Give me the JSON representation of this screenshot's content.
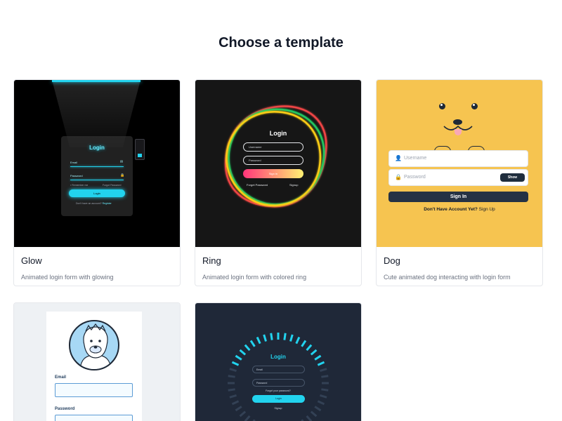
{
  "page": {
    "title": "Choose a template"
  },
  "templates": [
    {
      "name": "Glow",
      "description": "Animated login form with glowing",
      "preview": {
        "title": "Login",
        "email_label": "Email",
        "password_label": "Password",
        "remember_label": "Remember me",
        "forgot_label": "Forgot Password",
        "button_label": "Login",
        "signup_text": "Don't have an account?",
        "signup_link": "Register",
        "accent_color": "#22d3ee"
      }
    },
    {
      "name": "Ring",
      "description": "Animated login form with colored ring",
      "preview": {
        "title": "Login",
        "username_placeholder": "Username",
        "password_placeholder": "Password",
        "button_label": "Sign in",
        "forgot_label": "Forget Password",
        "signup_label": "Signup",
        "ring_colors": [
          "#ef4444",
          "#22c55e",
          "#facc15"
        ]
      }
    },
    {
      "name": "Dog",
      "description": "Cute animated dog interacting with login form",
      "preview": {
        "username_placeholder": "Username",
        "password_placeholder": "Password",
        "show_label": "Show",
        "button_label": "Sign In",
        "account_text": "Don't Have Account Yet?",
        "signup_link": "Sign Up",
        "background_color": "#f6c450"
      }
    },
    {
      "preview": {
        "email_label": "Email",
        "password_label": "Password",
        "accent_color": "#5b9bd5"
      }
    },
    {
      "preview": {
        "title": "Login",
        "email_label": "Email",
        "password_label": "Password",
        "forgot_label": "Forgot your password?",
        "button_label": "Login",
        "signup_label": "Signup",
        "accent_color": "#22d3ee"
      }
    }
  ]
}
